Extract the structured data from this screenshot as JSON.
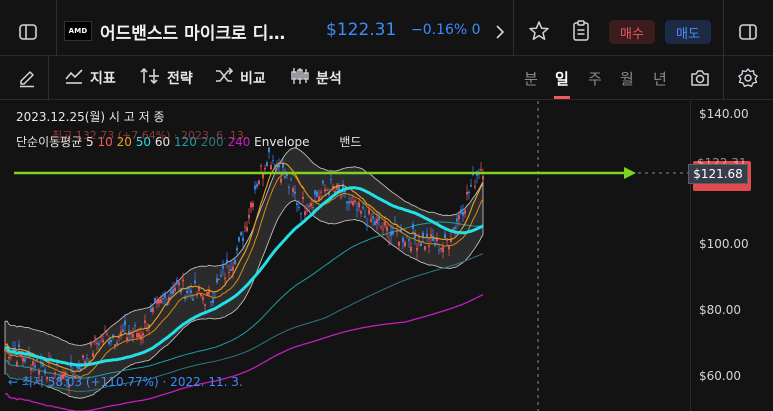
{
  "header": {
    "ticker_logo": "AMD",
    "title": "어드밴스드 마이크로 디…",
    "price": "$122.31",
    "change": "−0.16%  0",
    "buy_label": "매수",
    "sell_label": "매도"
  },
  "toolbar": {
    "indicator_label": "지표",
    "strategy_label": "전략",
    "compare_label": "비교",
    "analysis_label": "분석",
    "timeframes": [
      "분",
      "일",
      "주",
      "월",
      "년"
    ],
    "active_timeframe": "일"
  },
  "legend": {
    "date": "2023.12.25(월)  시  고  저  종",
    "ma_label": "단순이동평균 5",
    "ma_periods": [
      "10",
      "20",
      "50",
      "60",
      "120",
      "200",
      "240"
    ],
    "ma_tail": "Envelope",
    "bands_label": "밴드",
    "high_note": "최고 132.73 (+7.64%) · 2023. 6. 13.",
    "low_note": "← 최저 58.03 (+110.77%) · 2022. 11. 3."
  },
  "price_axis": {
    "labels": [
      "$140.00",
      "$100.00",
      "$80.00",
      "$60.00"
    ],
    "current_price_tag": "$122.31",
    "crosshair_price": "$121.68"
  },
  "colors": {
    "background": "#131313",
    "price_blue": "#3b8cff",
    "buy_red": "#f0595f",
    "sell_blue": "#4d8df5",
    "hline_green": "#7ed321",
    "ma_cyan": "#22e0e6",
    "ma_orange": "#f0a020",
    "ma_magenta": "#c21ec2"
  }
}
